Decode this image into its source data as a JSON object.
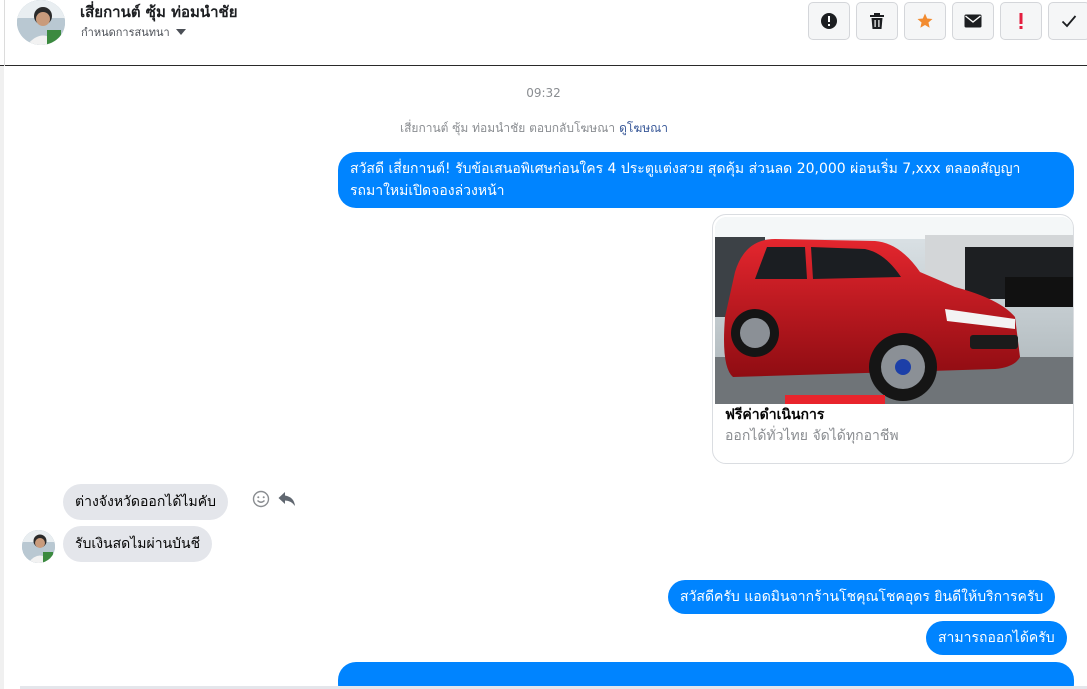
{
  "header": {
    "contact_name": "เสี่ยกานต์ ซุ้ม ท่อมนำชัย",
    "assign_label": "กำหนดการสนทนา",
    "toolbar": [
      {
        "name": "alert-icon",
        "label": "!"
      },
      {
        "name": "trash-icon",
        "label": ""
      },
      {
        "name": "star-icon",
        "label": ""
      },
      {
        "name": "mail-icon",
        "label": ""
      },
      {
        "name": "important-icon",
        "label": "!"
      },
      {
        "name": "check-icon",
        "label": ""
      }
    ]
  },
  "colors": {
    "bubble_out": "#0084ff",
    "bubble_in": "#e4e6eb",
    "star": "#f28b30",
    "important": "#e41e3f",
    "link": "#385898"
  },
  "thread": {
    "timestamp": "09:32",
    "ad_reply_text": "เสี่ยกานต์ ซุ้ม ท่อมนำชัย ตอบกลับโฆษณา",
    "ad_reply_link": "ดูโฆษณา",
    "outgoing_ad_message": {
      "line1": "สวัสดี เสี่ยกานต์! รับข้อเสนอพิเศษก่อนใคร 4 ประตูแต่งสวย สุดคุ้ม ส่วนลด 20,000 ผ่อนเริ่ม 7,xxx ตลอดสัญญา",
      "line2": "รถมาใหม่เปิดจองล่วงหน้า"
    },
    "ad_card": {
      "title": "ฟรีค่าดำเนินการ",
      "subtitle": "ออกได้ทั่วไทย จัดได้ทุกอาชีพ"
    },
    "incoming": [
      {
        "text": "ต่างจังหวัดออกได้ไมคับ"
      },
      {
        "text": "รับเงินสดไมผ่านบันชี"
      }
    ],
    "outgoing": [
      {
        "text": "สวัสดีครับ แอดมินจากร้านโชคุณโชคอุดร ยินดีให้บริการครับ"
      },
      {
        "text": "สามารถออกได้ครับ"
      }
    ]
  }
}
